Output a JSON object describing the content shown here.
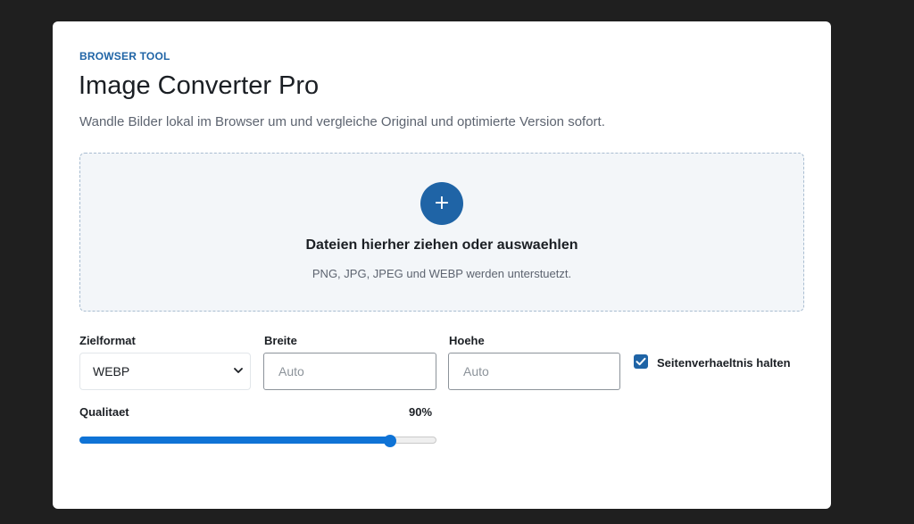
{
  "header": {
    "eyebrow": "BROWSER TOOL",
    "title": "Image Converter Pro",
    "subtitle": "Wandle Bilder lokal im Browser um und vergleiche Original und optimierte Version sofort."
  },
  "dropzone": {
    "icon": "plus-icon",
    "icon_glyph": "+",
    "title": "Dateien hierher ziehen oder auswaehlen",
    "hint": "PNG, JPG, JPEG und WEBP werden unterstuetzt."
  },
  "settings": {
    "format_label": "Zielformat",
    "format_value": "WEBP",
    "width_label": "Breite",
    "width_placeholder": "Auto",
    "height_label": "Hoehe",
    "height_placeholder": "Auto",
    "aspect_label": "Seitenverhaeltnis halten",
    "aspect_checked": true,
    "quality_label": "Qualitaet",
    "quality_display": "90%",
    "quality_value": 0.87
  },
  "colors": {
    "accent": "#1f64a6",
    "slider": "#0f73d6",
    "background": "#1f1f1f",
    "card": "#ffffff",
    "dropzone_bg": "#f3f6f9"
  }
}
